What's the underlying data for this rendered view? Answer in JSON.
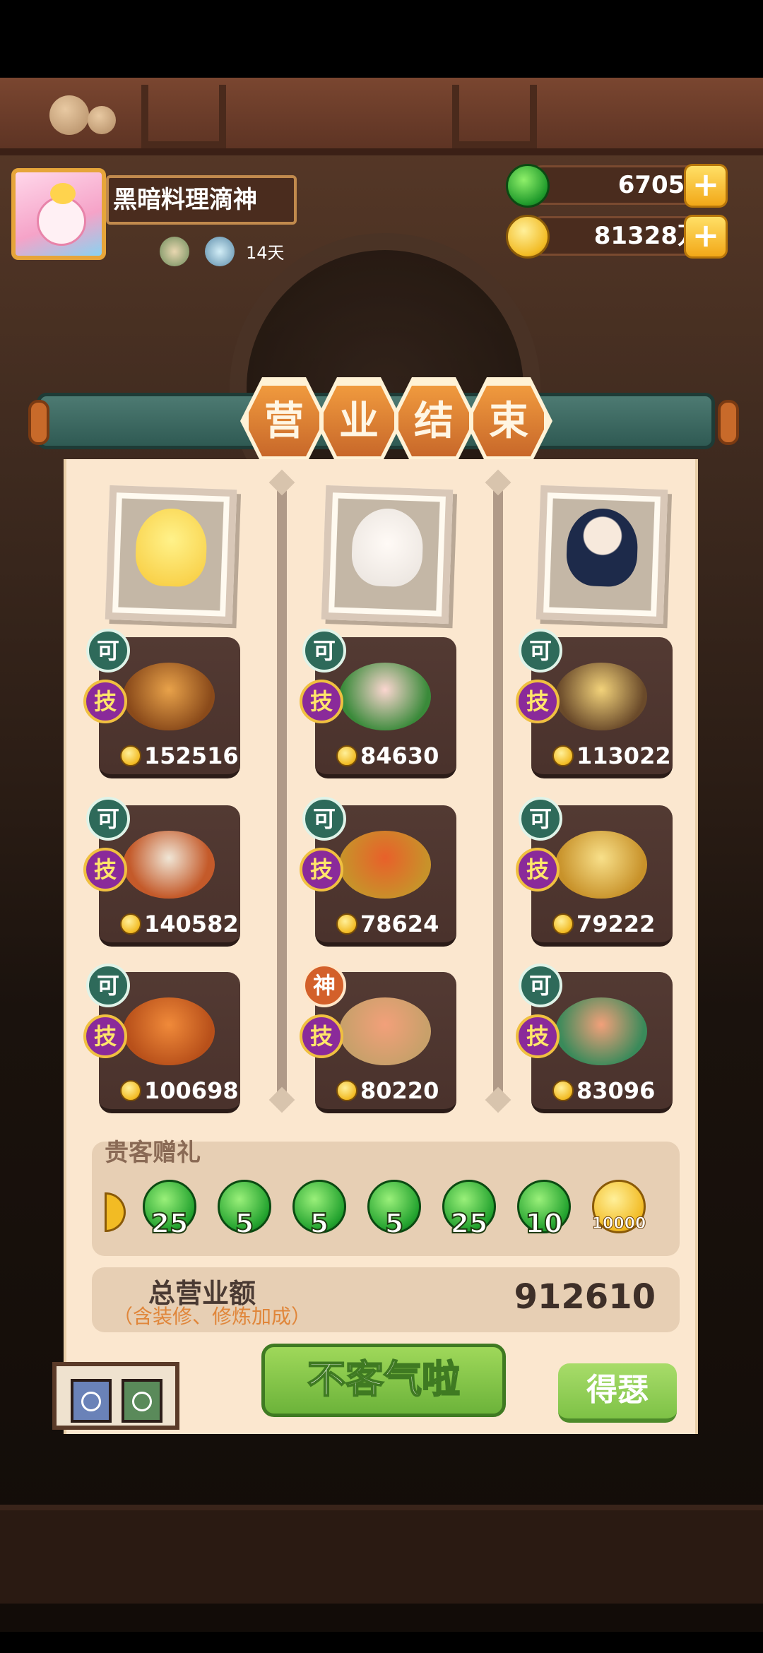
{
  "player": {
    "name": "黑暗料理滴神",
    "days": "14天"
  },
  "currencies": {
    "jade": "67054",
    "gold": "81328万"
  },
  "title_chars": [
    "营",
    "业",
    "结",
    "束"
  ],
  "columns": [
    {
      "character": "chick",
      "dishes": [
        {
          "badge": "可",
          "skill": "技",
          "price": "152516"
        },
        {
          "badge": "可",
          "skill": "技",
          "price": "140582"
        },
        {
          "badge": "可",
          "skill": "技",
          "price": "100698"
        }
      ]
    },
    {
      "character": "girl",
      "dishes": [
        {
          "badge": "可",
          "skill": "技",
          "price": "84630"
        },
        {
          "badge": "可",
          "skill": "技",
          "price": "78624"
        },
        {
          "badge": "神",
          "skill": "技",
          "price": "80220"
        }
      ]
    },
    {
      "character": "boy",
      "dishes": [
        {
          "badge": "可",
          "skill": "技",
          "price": "113022"
        },
        {
          "badge": "可",
          "skill": "技",
          "price": "79222"
        },
        {
          "badge": "可",
          "skill": "技",
          "price": "83096"
        }
      ]
    }
  ],
  "gifts": {
    "title": "贵客赠礼",
    "items": [
      {
        "type": "jade",
        "qty": "25"
      },
      {
        "type": "jade",
        "qty": "5"
      },
      {
        "type": "jade",
        "qty": "5"
      },
      {
        "type": "jade",
        "qty": "5"
      },
      {
        "type": "jade",
        "qty": "25"
      },
      {
        "type": "jade",
        "qty": "10"
      },
      {
        "type": "gold",
        "qty": "10000"
      }
    ]
  },
  "total": {
    "label": "总营业额",
    "sub": "（含装修、修炼加成）",
    "value": "912610"
  },
  "buttons": {
    "confirm": "不客气啦",
    "show_off": "得瑟"
  },
  "colors": {
    "panel": "#fbe7cf",
    "card": "#4a322c",
    "accent_orange": "#c8682a",
    "banner_teal": "#2f5a53",
    "button_green": "#6cb33a"
  }
}
